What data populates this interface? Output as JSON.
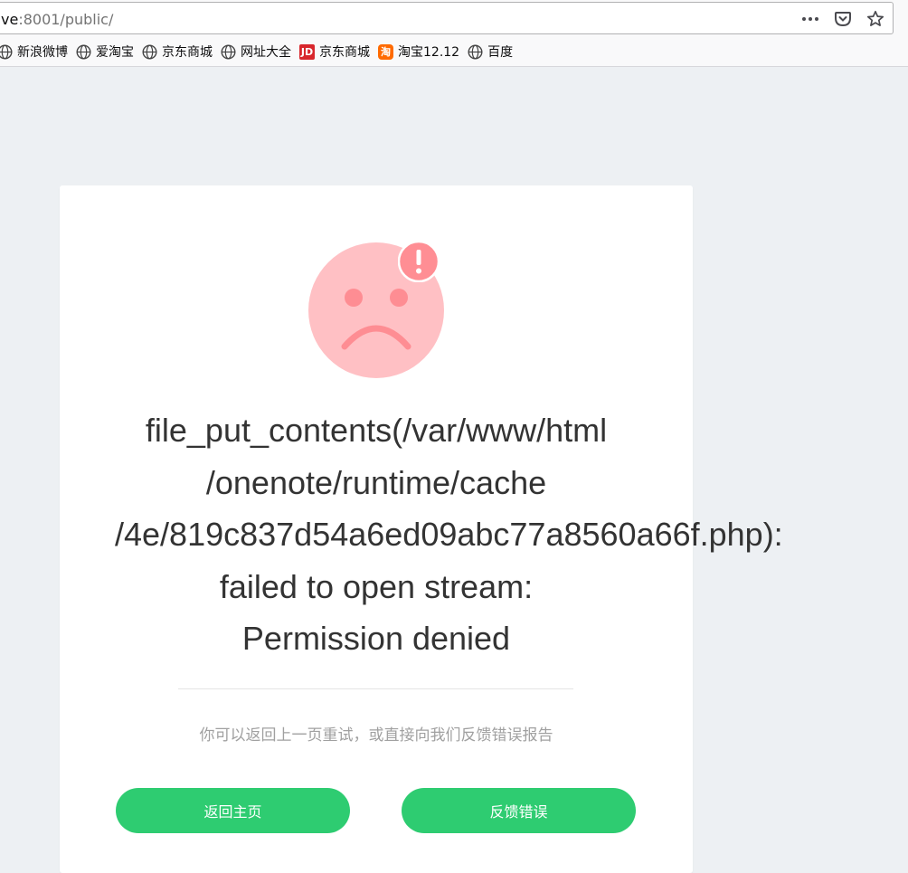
{
  "browser": {
    "url": {
      "host_fragment": "ve",
      "rest": ":8001/public/"
    },
    "actions": [
      {
        "name": "page-actions-icon",
        "glyph": "•••"
      },
      {
        "name": "pocket-icon"
      },
      {
        "name": "bookmark-star-icon"
      }
    ],
    "bookmarks": [
      {
        "label": "新浪微博",
        "icon": "globe-icon"
      },
      {
        "label": "爱淘宝",
        "icon": "globe-icon"
      },
      {
        "label": "京东商城",
        "icon": "globe-icon"
      },
      {
        "label": "网址大全",
        "icon": "globe-icon"
      },
      {
        "label": "京东商城",
        "icon": "jd-logo-icon",
        "icon_text": "JD"
      },
      {
        "label": "淘宝12.12",
        "icon": "taobao-logo-icon",
        "icon_text": "淘"
      },
      {
        "label": "百度",
        "icon": "globe-icon"
      }
    ]
  },
  "error_page": {
    "icon": "sad-face-icon",
    "badge_icon": "exclamation-badge-icon",
    "message_lines": [
      "file_put_contents(/var/www/html",
      "/onenote/runtime/cache",
      "/4e/819c837d54a6ed09abc77a8560a66f.php):",
      "failed to open stream:",
      "Permission denied"
    ],
    "hint": "你可以返回上一页重试，或直接向我们反馈错误报告",
    "buttons": {
      "home_label": "返回主页",
      "report_label": "反馈错误"
    },
    "colors": {
      "face": "#ffc0c4",
      "face_features": "#fe8d93",
      "badge": "#ff8e94",
      "button": "#2ecc71",
      "background": "#edf0f3"
    }
  }
}
